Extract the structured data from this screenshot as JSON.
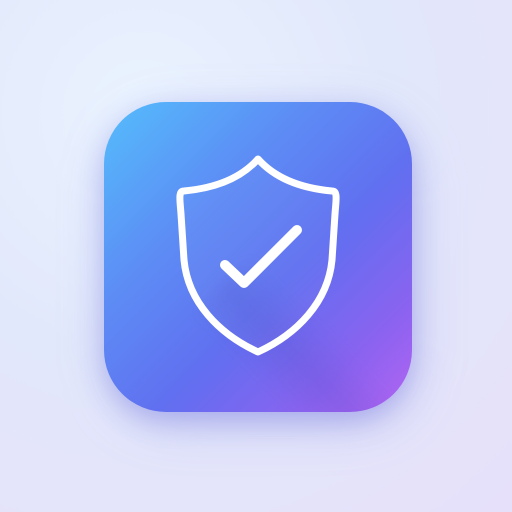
{
  "icon": {
    "name": "shield-check-icon",
    "gradient_colors": [
      "#3fb4fb",
      "#5588f5",
      "#5f6ff0",
      "#8a63f0",
      "#b364f2"
    ],
    "stroke_color": "#ffffff",
    "background_color": "#e4e8fb"
  }
}
